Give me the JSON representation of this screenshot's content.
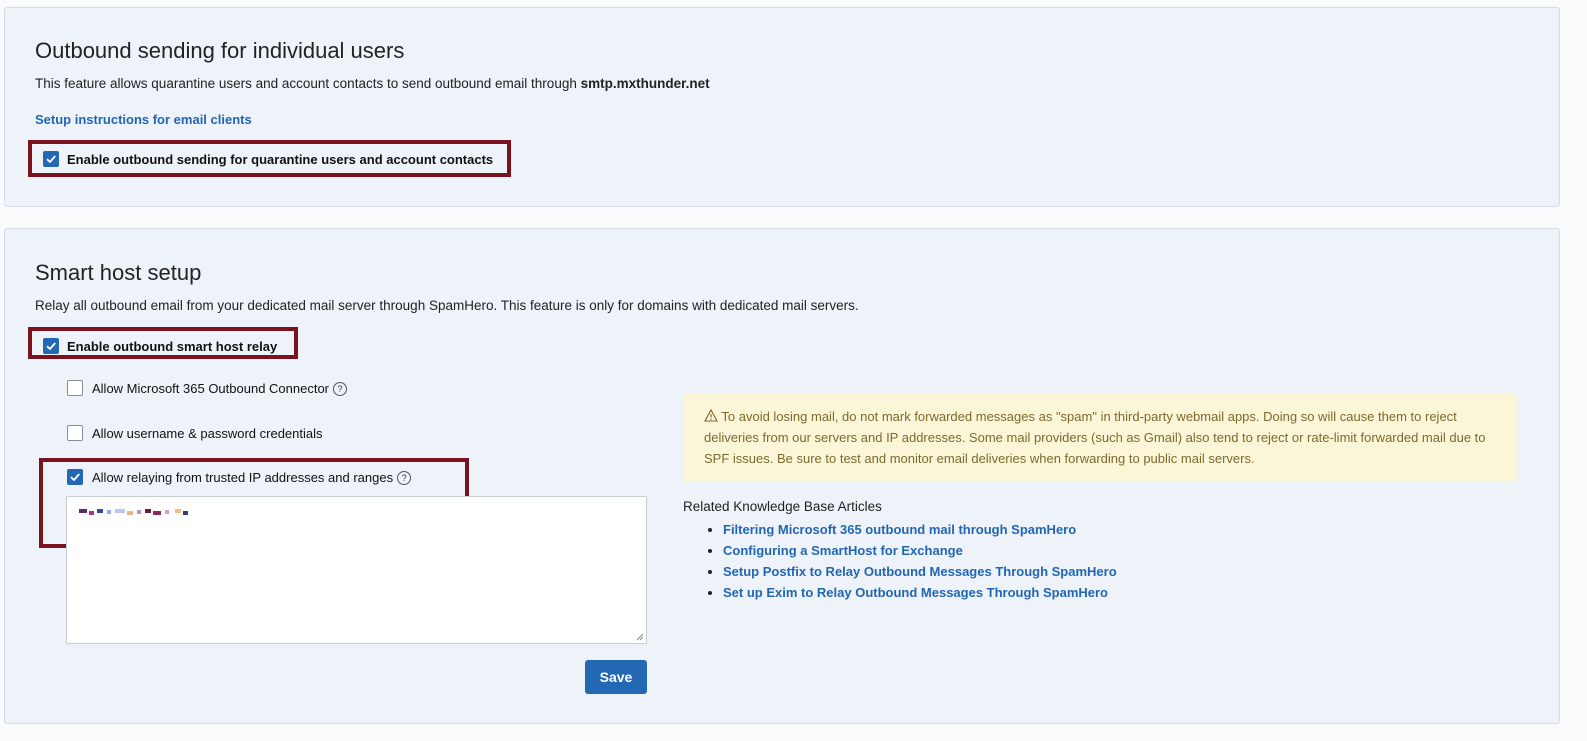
{
  "outbound": {
    "title": "Outbound sending for individual users",
    "description_prefix": "This feature allows quarantine users and account contacts to send outbound email through ",
    "smtp_host": "smtp.mxthunder.net",
    "setup_link": "Setup instructions for email clients",
    "enable_label": "Enable outbound sending for quarantine users and account contacts",
    "enable_checked": true
  },
  "smarthost": {
    "title": "Smart host setup",
    "description": "Relay all outbound email from your dedicated mail server through SpamHero. This feature is only for domains with dedicated mail servers.",
    "enable_label": "Enable outbound smart host relay",
    "enable_checked": true,
    "options": [
      {
        "label": "Allow Microsoft 365 Outbound Connector",
        "checked": false,
        "help": "?"
      },
      {
        "label": "Allow username & password credentials",
        "checked": false
      },
      {
        "label": "Allow relaying from trusted IP addresses and ranges",
        "checked": true,
        "help": "?"
      }
    ],
    "save_label": "Save",
    "warning_icon": "warning-triangle-icon",
    "warning": "To avoid losing mail, do not mark forwarded messages as \"spam\" in third-party webmail apps. Doing so will cause them to reject deliveries from our servers and IP addresses. Some mail providers (such as Gmail) also tend to reject or rate-limit forwarded mail due to SPF issues. Be sure to test and monitor email deliveries when forwarding to public mail servers.",
    "kb_title": "Related Knowledge Base Articles",
    "kb_articles": [
      "Filtering Microsoft 365 outbound mail through SpamHero",
      "Configuring a SmartHost for Exchange",
      "Setup Postfix to Relay Outbound Messages Through SpamHero",
      "Set up Exim to Relay Outbound Messages Through SpamHero"
    ]
  },
  "colors": {
    "accent": "#2468b4",
    "link": "#2266b3",
    "highlight_border": "#7a1220",
    "warning_bg": "#fcf6d8",
    "panel_bg": "#eef3fa"
  }
}
